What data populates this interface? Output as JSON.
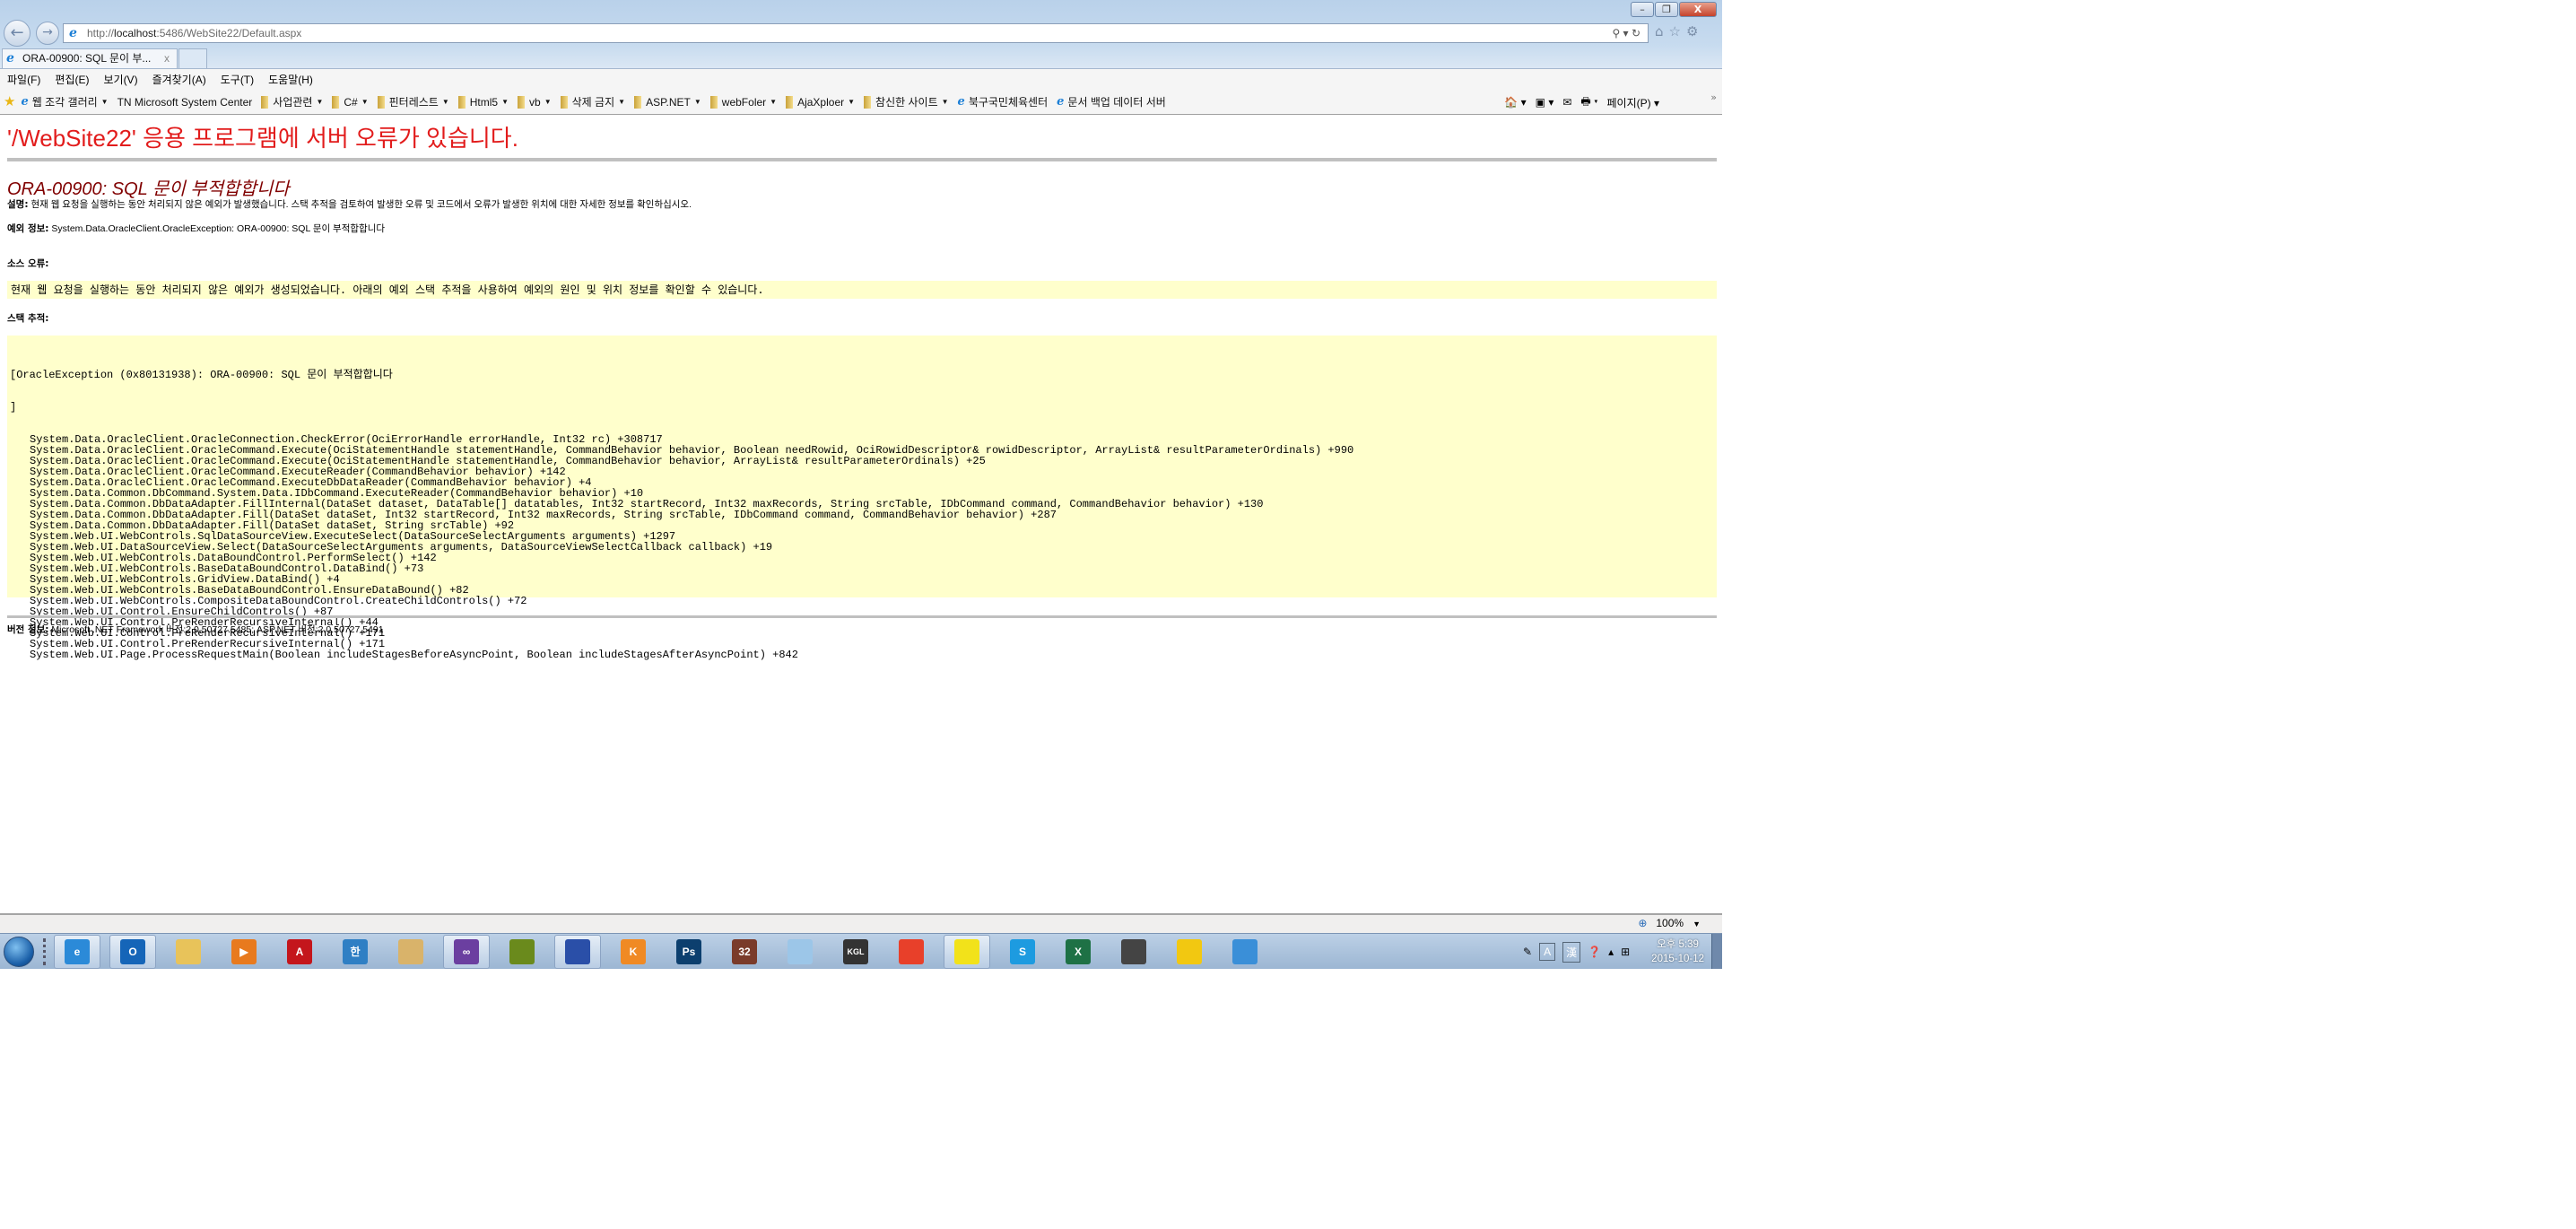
{
  "browser": {
    "url_prefix": "http://",
    "url_host": "localhost",
    "url_rest": ":5486/WebSite22/Default.aspx",
    "tab_title": "ORA-00900: SQL 문이 부...",
    "menu": [
      "파일(F)",
      "편집(E)",
      "보기(V)",
      "즐겨찾기(A)",
      "도구(T)",
      "도움말(H)"
    ],
    "favorites": [
      {
        "label": "웹 조각 갤러리",
        "icon": "ie-icon",
        "dropdown": true
      },
      {
        "label": "TN Microsoft System Center",
        "icon": "none",
        "dropdown": false
      },
      {
        "label": "사업관련",
        "icon": "folder-icon",
        "dropdown": true
      },
      {
        "label": "C#",
        "icon": "folder-icon",
        "dropdown": true
      },
      {
        "label": "핀터레스트",
        "icon": "folder-icon",
        "dropdown": true
      },
      {
        "label": "Html5",
        "icon": "folder-icon",
        "dropdown": true
      },
      {
        "label": "vb",
        "icon": "folder-icon",
        "dropdown": true
      },
      {
        "label": "삭제 금지",
        "icon": "folder-icon",
        "dropdown": true
      },
      {
        "label": "ASP.NET",
        "icon": "folder-icon",
        "dropdown": true
      },
      {
        "label": "webFoler",
        "icon": "folder-icon",
        "dropdown": true
      },
      {
        "label": "AjaXploer",
        "icon": "folder-icon",
        "dropdown": true
      },
      {
        "label": "참신한 사이트",
        "icon": "folder-icon",
        "dropdown": true
      },
      {
        "label": "북구국민체육센터",
        "icon": "ie-icon",
        "dropdown": false
      },
      {
        "label": "문서 백업 데이터 서버",
        "icon": "ie-icon",
        "dropdown": false
      }
    ],
    "page_menu": "페이지(P)",
    "zoom_level": "100%"
  },
  "page": {
    "title": "'/WebSite22' 응용 프로그램에 서버 오류가 있습니다.",
    "error_heading": "ORA-00900: SQL 문이 부적합합니다",
    "description_label": "설명:",
    "description": "현재 웹 요청을 실행하는 동안 처리되지 않은 예외가 발생했습니다. 스택 추적을 검토하여 발생한 오류 및 코드에서 오류가 발생한 위치에 대한 자세한 정보를 확인하십시오.",
    "exception_label": "예외 정보:",
    "exception": "System.Data.OracleClient.OracleException: ORA-00900: SQL 문이 부적합합니다",
    "source_label": "소스 오류:",
    "source_text": "현재 웹 요청을 실행하는 동안 처리되지 않은 예외가 생성되었습니다. 아래의 예외 스택 추적을 사용하여 예외의 원인 및 위치 정보를 확인할 수 있습니다.",
    "stack_label": "스택 추적:",
    "stack_header": "[OracleException (0x80131938): ORA-00900: SQL 문이 부적합합니다",
    "stack_close": "]",
    "stack_frames": [
      "System.Data.OracleClient.OracleConnection.CheckError(OciErrorHandle errorHandle, Int32 rc) +308717",
      "System.Data.OracleClient.OracleCommand.Execute(OciStatementHandle statementHandle, CommandBehavior behavior, Boolean needRowid, OciRowidDescriptor& rowidDescriptor, ArrayList& resultParameterOrdinals) +990",
      "System.Data.OracleClient.OracleCommand.Execute(OciStatementHandle statementHandle, CommandBehavior behavior, ArrayList& resultParameterOrdinals) +25",
      "System.Data.OracleClient.OracleCommand.ExecuteReader(CommandBehavior behavior) +142",
      "System.Data.OracleClient.OracleCommand.ExecuteDbDataReader(CommandBehavior behavior) +4",
      "System.Data.Common.DbCommand.System.Data.IDbCommand.ExecuteReader(CommandBehavior behavior) +10",
      "System.Data.Common.DbDataAdapter.FillInternal(DataSet dataset, DataTable[] datatables, Int32 startRecord, Int32 maxRecords, String srcTable, IDbCommand command, CommandBehavior behavior) +130",
      "System.Data.Common.DbDataAdapter.Fill(DataSet dataSet, Int32 startRecord, Int32 maxRecords, String srcTable, IDbCommand command, CommandBehavior behavior) +287",
      "System.Data.Common.DbDataAdapter.Fill(DataSet dataSet, String srcTable) +92",
      "System.Web.UI.WebControls.SqlDataSourceView.ExecuteSelect(DataSourceSelectArguments arguments) +1297",
      "System.Web.UI.DataSourceView.Select(DataSourceSelectArguments arguments, DataSourceViewSelectCallback callback) +19",
      "System.Web.UI.WebControls.DataBoundControl.PerformSelect() +142",
      "System.Web.UI.WebControls.BaseDataBoundControl.DataBind() +73",
      "System.Web.UI.WebControls.GridView.DataBind() +4",
      "System.Web.UI.WebControls.BaseDataBoundControl.EnsureDataBound() +82",
      "System.Web.UI.WebControls.CompositeDataBoundControl.CreateChildControls() +72",
      "System.Web.UI.Control.EnsureChildControls() +87",
      "System.Web.UI.Control.PreRenderRecursiveInternal() +44",
      "System.Web.UI.Control.PreRenderRecursiveInternal() +171",
      "System.Web.UI.Control.PreRenderRecursiveInternal() +171",
      "System.Web.UI.Page.ProcessRequestMain(Boolean includeStagesBeforeAsyncPoint, Boolean includeStagesAfterAsyncPoint) +842"
    ],
    "version_label": "버전 정보:",
    "version": "Microsoft .NET Framework 버전:2.0.50727.5485; ASP.NET 버전:2.0.50727.5491"
  },
  "taskbar": {
    "apps": [
      {
        "name": "internet-explorer",
        "glyph": "e",
        "color": "#2b8ad8",
        "active": true
      },
      {
        "name": "outlook",
        "glyph": "O",
        "color": "#1565b8",
        "active": true
      },
      {
        "name": "file-explorer",
        "glyph": "",
        "color": "#e8c35a",
        "active": false
      },
      {
        "name": "media-player",
        "glyph": "▶",
        "color": "#e87a1e",
        "active": false
      },
      {
        "name": "acrobat",
        "glyph": "A",
        "color": "#c4161c",
        "active": false
      },
      {
        "name": "hangul-editor",
        "glyph": "한",
        "color": "#2f7fc4",
        "active": false
      },
      {
        "name": "paint",
        "glyph": "",
        "color": "#d9b36a",
        "active": false
      },
      {
        "name": "visual-studio",
        "glyph": "∞",
        "color": "#6b3fa0",
        "active": true
      },
      {
        "name": "frog-app",
        "glyph": "",
        "color": "#6a8a1c",
        "active": false
      },
      {
        "name": "remote-desktop",
        "glyph": "",
        "color": "#2a4fa8",
        "active": true
      },
      {
        "name": "kakao-k3",
        "glyph": "K",
        "color": "#f08a24",
        "active": false
      },
      {
        "name": "photoshop",
        "glyph": "Ps",
        "color": "#0c3f6e",
        "active": false
      },
      {
        "name": "calendar-app",
        "glyph": "32",
        "color": "#7a3b2a",
        "active": false
      },
      {
        "name": "notepad",
        "glyph": "",
        "color": "#9cc6e8",
        "active": false
      },
      {
        "name": "kgl-app",
        "glyph": "KGL",
        "color": "#333333",
        "active": false
      },
      {
        "name": "gom-player",
        "glyph": "",
        "color": "#e8402a",
        "active": false
      },
      {
        "name": "eraser-app",
        "glyph": "",
        "color": "#f2e21a",
        "active": true
      },
      {
        "name": "skype",
        "glyph": "S",
        "color": "#1d9be0",
        "active": false
      },
      {
        "name": "excel",
        "glyph": "X",
        "color": "#1e7145",
        "active": false
      },
      {
        "name": "camera-app",
        "glyph": "",
        "color": "#444444",
        "active": false
      },
      {
        "name": "powerbi",
        "glyph": "",
        "color": "#f2c811",
        "active": false
      },
      {
        "name": "control-panel",
        "glyph": "",
        "color": "#3a8fd8",
        "active": false
      }
    ],
    "ime_mode": "A",
    "ime_hanja": "漢",
    "time": "오후 5:39",
    "date": "2015-10-12"
  }
}
